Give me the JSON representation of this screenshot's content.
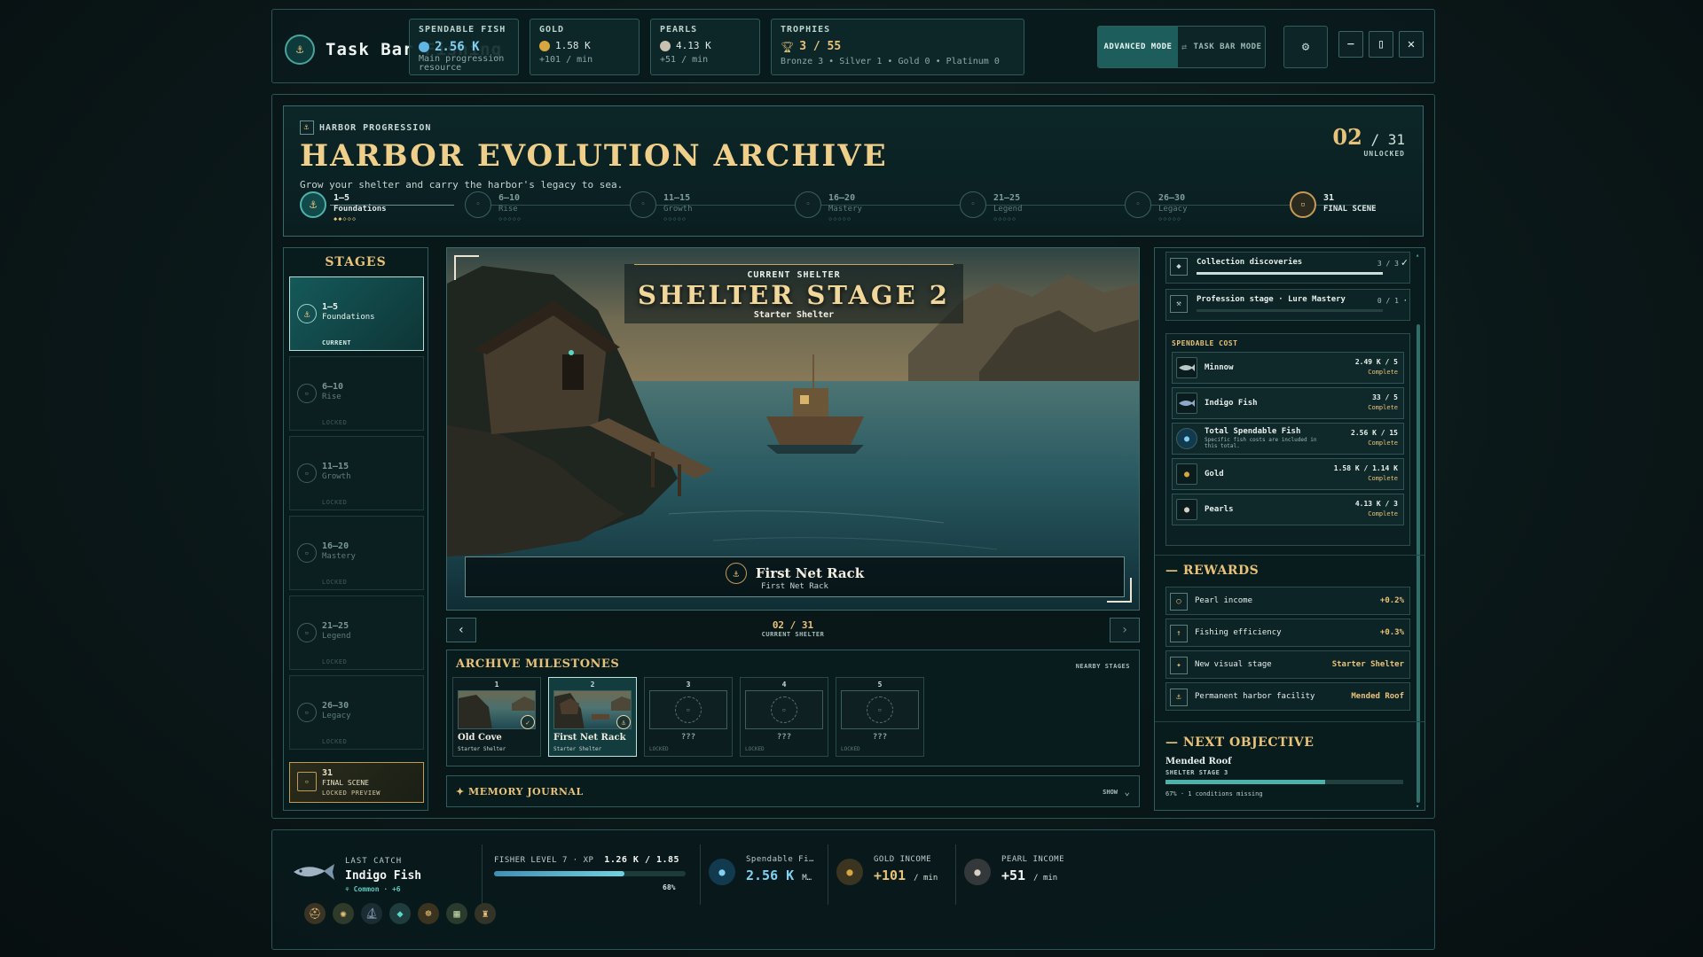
{
  "app": {
    "title": "Task Bar Fishing"
  },
  "resources": {
    "fish": {
      "label": "SPENDABLE FISH",
      "value": "2.56 K",
      "sub": "Main progression resource",
      "icon": "fish-icon",
      "color": "#5fb7e5"
    },
    "gold": {
      "label": "GOLD",
      "value": "1.58 K",
      "sub": "+101 / min",
      "icon": "gold-coin-icon",
      "color": "#d8a640"
    },
    "pearls": {
      "label": "PEARLS",
      "value": "4.13 K",
      "sub": "+51 / min",
      "icon": "pearl-icon",
      "color": "#c9c2b3"
    },
    "trophies": {
      "label": "TROPHIES",
      "value": "3 / 55",
      "sub": "Bronze 3 • Silver 1 • Gold 0 • Platinum 0",
      "icon": "trophy-icon",
      "color": "#e9c27a"
    }
  },
  "modes": {
    "advanced": "ADVANCED MODE",
    "separator": "⇄",
    "taskbar": "TASK BAR MODE"
  },
  "header": {
    "kicker": "HARBOR PROGRESSION",
    "title": "HARBOR EVOLUTION ARCHIVE",
    "subtitle": "Grow your shelter and carry the harbor's legacy to sea.",
    "unlocked_count": "02",
    "unlocked_total": "/ 31",
    "unlocked_label": "UNLOCKED",
    "track": [
      {
        "range": "1–5",
        "name": "Foundations",
        "dots": "◆◆◇◇◇",
        "state": "active"
      },
      {
        "range": "6–10",
        "name": "Rise",
        "dots": "◇◇◇◇◇",
        "state": "locked"
      },
      {
        "range": "11–15",
        "name": "Growth",
        "dots": "◇◇◇◇◇",
        "state": "locked"
      },
      {
        "range": "16–20",
        "name": "Mastery",
        "dots": "◇◇◇◇◇",
        "state": "locked"
      },
      {
        "range": "21–25",
        "name": "Legend",
        "dots": "◇◇◇◇◇",
        "state": "locked"
      },
      {
        "range": "26–30",
        "name": "Legacy",
        "dots": "◇◇◇◇◇",
        "state": "locked"
      },
      {
        "range": "31",
        "name": "FINAL SCENE",
        "dots": "",
        "state": "final"
      }
    ]
  },
  "stages": {
    "title": "STAGES",
    "items": [
      {
        "range": "1–5",
        "name": "Foundations",
        "status": "CURRENT"
      },
      {
        "range": "6–10",
        "name": "Rise",
        "status": "LOCKED"
      },
      {
        "range": "11–15",
        "name": "Growth",
        "status": "LOCKED"
      },
      {
        "range": "16–20",
        "name": "Mastery",
        "status": "LOCKED"
      },
      {
        "range": "21–25",
        "name": "Legend",
        "status": "LOCKED"
      },
      {
        "range": "26–30",
        "name": "Legacy",
        "status": "LOCKED"
      }
    ],
    "final": {
      "range": "31",
      "name": "FINAL SCENE",
      "status": "LOCKED PREVIEW"
    }
  },
  "scene": {
    "kicker": "CURRENT SHELTER",
    "title": "SHELTER STAGE 2",
    "subtitle": "Starter Shelter",
    "caption_title": "First Net Rack",
    "caption_sub": "First Net Rack",
    "nav_count": "02 / 31",
    "nav_label": "CURRENT SHELTER"
  },
  "milestones": {
    "title": "ARCHIVE MILESTONES",
    "nearby": "NEARBY STAGES",
    "items": [
      {
        "num": "1",
        "name": "Old Cove",
        "stage": "Starter Shelter",
        "state": "done"
      },
      {
        "num": "2",
        "name": "First Net Rack",
        "stage": "Starter Shelter",
        "state": "selected"
      },
      {
        "num": "3",
        "name": "???",
        "stage": "LOCKED",
        "state": "locked"
      },
      {
        "num": "4",
        "name": "???",
        "stage": "LOCKED",
        "state": "locked"
      },
      {
        "num": "5",
        "name": "???",
        "stage": "LOCKED",
        "state": "locked"
      }
    ]
  },
  "journal": {
    "title": "MEMORY JOURNAL",
    "show": "SHOW"
  },
  "requirements": [
    {
      "title": "Collection discoveries",
      "value": "3 / 3",
      "progress": 1.0,
      "done": true
    },
    {
      "title": "Profession stage · Lure Mastery",
      "value": "0 / 1",
      "progress": 0.0,
      "done": false
    }
  ],
  "cost": {
    "title": "SPENDABLE COST",
    "items": [
      {
        "name": "Minnow",
        "desc": "",
        "value": "2.49 K / 5",
        "status": "Complete",
        "icon": "minnow-icon"
      },
      {
        "name": "Indigo Fish",
        "desc": "",
        "value": "33 / 5",
        "status": "Complete",
        "icon": "indigo-fish-icon"
      },
      {
        "name": "Total Spendable Fish",
        "desc": "Specific fish costs are included in this total.",
        "value": "2.56 K / 15",
        "status": "Complete",
        "icon": "fish-icon"
      },
      {
        "name": "Gold",
        "desc": "",
        "value": "1.58 K / 1.14 K",
        "status": "Complete",
        "icon": "gold-coin-icon"
      },
      {
        "name": "Pearls",
        "desc": "",
        "value": "4.13 K / 3",
        "status": "Complete",
        "icon": "pearl-icon"
      }
    ]
  },
  "rewards": {
    "title": "REWARDS",
    "items": [
      {
        "name": "Pearl income",
        "value": "+0.2%",
        "icon": "pearl-icon"
      },
      {
        "name": "Fishing efficiency",
        "value": "+0.3%",
        "icon": "rod-icon"
      },
      {
        "name": "New visual stage",
        "value": "Starter Shelter",
        "icon": "sparkle-icon"
      },
      {
        "name": "Permanent harbor facility",
        "value": "Mended Roof",
        "icon": "anchor-icon"
      }
    ]
  },
  "objective": {
    "title": "NEXT OBJECTIVE",
    "name": "Mended Roof",
    "stage": "SHELTER STAGE 3",
    "progress": 0.67,
    "note": "67% · 1 conditions missing"
  },
  "bottom": {
    "last_catch_label": "LAST CATCH",
    "last_catch_name": "Indigo Fish",
    "last_catch_rarity": "⚘ Common · +6",
    "level_label": "FISHER LEVEL 7 · XP",
    "level_xp": "1.26 K / 1.85",
    "level_progress": 0.68,
    "level_pct": "68%",
    "spendable_label": "Spendable Fi…",
    "spendable_value": "2.56 K",
    "spendable_unit": "M…",
    "gold_label": "GOLD INCOME",
    "gold_value": "+101",
    "gold_unit": "/ min",
    "pearl_label": "PEARL INCOME",
    "pearl_value": "+51",
    "pearl_unit": "/ min"
  }
}
